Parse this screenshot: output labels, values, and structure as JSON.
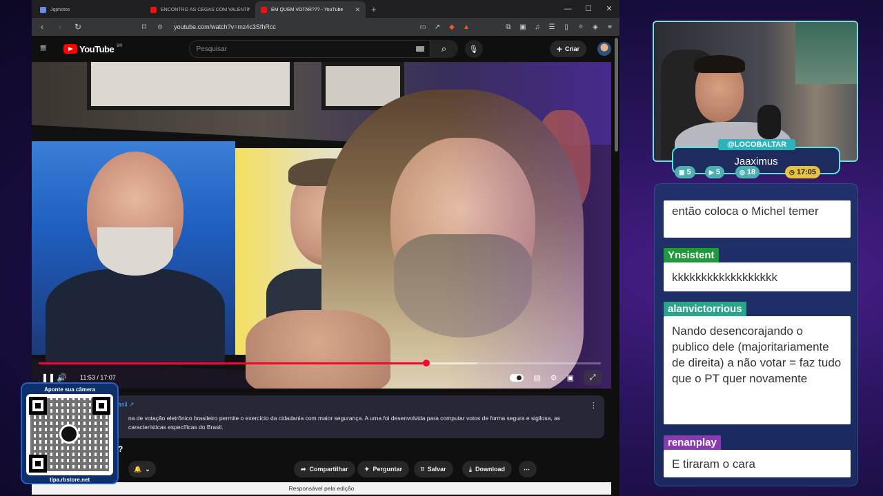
{
  "browser": {
    "tabs": [
      {
        "label": "Jqphotos",
        "active": false
      },
      {
        "label": "ENCONTRO ÀS CEGAS COM VALENTINA BAU",
        "active": false
      },
      {
        "label": "EM QUEM VOTAR??? - YouTube",
        "active": true
      }
    ],
    "url": "youtube.com/watch?v=mz4c3SfhRcc"
  },
  "youtube": {
    "logo_text": "YouTube",
    "region": "BR",
    "search_placeholder": "Pesquisar",
    "create_label": "Criar",
    "player": {
      "time": "11:53 / 17:07",
      "progress": 0.69,
      "buffered": 0.78
    },
    "info_card": {
      "source": "rasil ↗",
      "text": "na de votação eletrônico brasileiro permite o exercício da cidadania com maior segurança. A urna foi desenvolvida para computar votos de forma segura e sigilosa, as características específicas do Brasil."
    },
    "title_fragment": "?",
    "actions": {
      "share": "Compartilhar",
      "ask": "Perguntar",
      "save": "Salvar",
      "download": "Download"
    },
    "footer": "Responsável pela edição"
  },
  "qr_overlay": {
    "caption": "Aponte sua câmera",
    "url": "tipa.rbstore.net"
  },
  "stream": {
    "handle": "@LOCOBALTAR",
    "name": "Jaaximus",
    "badges": [
      {
        "icon": "twitch-icon",
        "value": "5"
      },
      {
        "icon": "youtube-icon",
        "value": "5"
      },
      {
        "icon": "kick-icon",
        "value": "18"
      },
      {
        "icon": "clock-icon",
        "value": "17:05"
      }
    ]
  },
  "chat": {
    "messages": [
      {
        "user": "",
        "text": "então coloca o Michel temer",
        "color": "#1f9a3a"
      },
      {
        "user": "Ynsistent",
        "text": "kkkkkkkkkkkkkkkkkk",
        "color": "#1f9a3a"
      },
      {
        "user": "alanvictorrious",
        "text": "Nando desencorajando o publico dele (majoritariamente de direita) a não votar = faz tudo que o PT quer novamente",
        "color": "#2aa58a"
      },
      {
        "user": "renanplay",
        "text": "E tiraram o cara",
        "color": "#8a3ab0"
      }
    ]
  },
  "colors": {
    "accent_red": "#ff0033",
    "cyan": "#5fe0e0",
    "gold": "#e8c23c"
  }
}
